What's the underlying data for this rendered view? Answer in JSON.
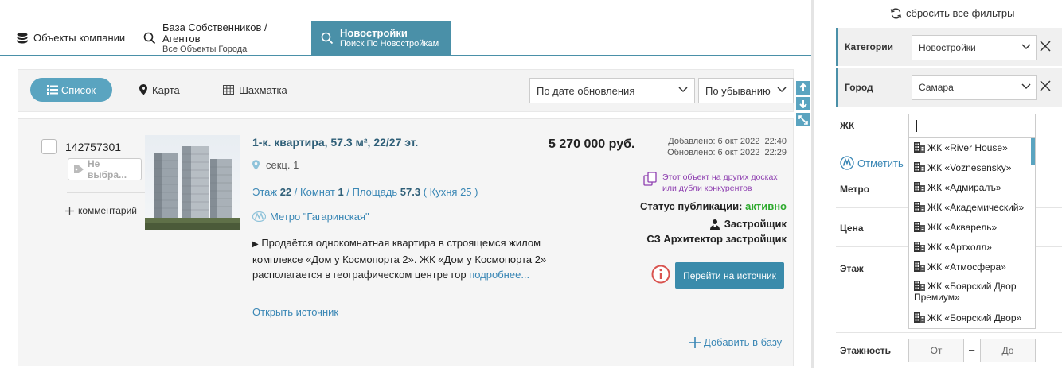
{
  "tabs": [
    {
      "title": "Объекты компании",
      "subtitle": ""
    },
    {
      "title": "База Собственников / Агентов",
      "subtitle": "Все Объекты Города"
    },
    {
      "title": "Новостройки",
      "subtitle": "Поиск По Новостройкам"
    }
  ],
  "toolbar": {
    "list": "Список",
    "map": "Карта",
    "chess": "Шахматка",
    "sort_field": "По дате обновления",
    "sort_order": "По убыванию"
  },
  "listing": {
    "id": "142757301",
    "not_selected": "Не выбра...",
    "comment": "комментарий",
    "title": "1-к. квартира, 57.3 м², 22/27 эт.",
    "address": "секц. 1",
    "floor_label": "Этаж",
    "floor": "22",
    "rooms_label": "Комнат",
    "rooms": "1",
    "area_label": "Площадь",
    "area": "57.3",
    "kitchen": "( Кухня 25 )",
    "metro": "Метро \"Гагаринская\"",
    "description": "Продаётся однокомнатная квартира в строящемся жилом комплексе «Дом у Космопорта 2». ЖК «Дом у Космопорта 2» располагается в географическом центре гор",
    "more": "подробнее...",
    "open_source": "Открыть источник",
    "price": "5 270 000 руб.",
    "added": "Добавлено: 6 окт 2022  22:40",
    "updated": "Обновлено: 6 окт 2022  22:29",
    "duplicates_line1": "Этот объект на других досках",
    "duplicates_line2": "или дубли конкурентов",
    "pub_status_label": "Статус публикации:",
    "pub_status_value": "активно",
    "developer_label": "Застройщик",
    "developer_name": "СЗ Архитектор застройщик",
    "go_source": "Перейти на источник",
    "add_to_base": "Добавить в базу"
  },
  "filters": {
    "reset": "сбросить все фильтры",
    "category_label": "Категории",
    "category_value": "Новостройки",
    "city_label": "Город",
    "city_value": "Самара",
    "jk_label": "ЖК",
    "mark_on_map": "Отметить",
    "metro_label": "Метро",
    "price_label": "Цена",
    "floor_label": "Этаж",
    "floors_total_label": "Этажность",
    "from_placeholder": "От",
    "to_placeholder": "До",
    "range_dash": "–",
    "jk_options": [
      "ЖК «River House»",
      "ЖК «Voznesensky»",
      "ЖК «Адмиралъ»",
      "ЖК «Академический»",
      "ЖК «Акварель»",
      "ЖК «Артхолл»",
      "ЖК «Атмосфера»",
      "ЖК «Боярский Двор Премиум»",
      "ЖК «Боярский Двор»"
    ]
  },
  "colors": {
    "accent": "#4a90a8",
    "link": "#3a87b5",
    "active_status": "#2eaa2e",
    "duplicates": "#8e3fb0",
    "info": "#d9534f"
  }
}
